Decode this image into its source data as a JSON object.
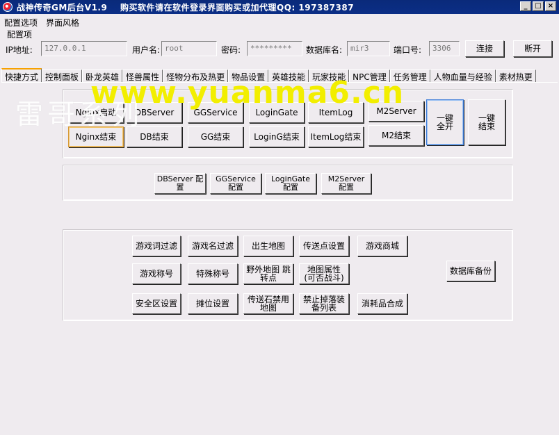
{
  "window": {
    "title": "战神传奇GM后台V1.9    购买软件请在软件登录界面购买或加代理QQ: 197387387",
    "buttons": {
      "minimize": "_",
      "maximize": "□",
      "close": "×"
    }
  },
  "menu": [
    "配置选项",
    "界面风格"
  ],
  "config": {
    "group_label": "配置项",
    "ip_label": "IP地址:",
    "ip_value": "127.0.0.1",
    "user_label": "用户名:",
    "user_value": "root",
    "password_label": "密码:",
    "password_value": "*********",
    "db_label": "数据库名:",
    "db_value": "mir3",
    "port_label": "端口号:",
    "port_value": "3306",
    "connect": "连接",
    "disconnect": "断开"
  },
  "tabs": [
    "快捷方式",
    "控制面板",
    "卧龙英雄",
    "怪兽属性",
    "怪物分布及热更",
    "物品设置",
    "英雄技能",
    "玩家技能",
    "NPC管理",
    "任务管理",
    "人物血量与经验",
    "素材热更"
  ],
  "server_buttons": {
    "start_row": [
      "Nginx启动",
      "DBServer",
      "GGService",
      "LoginGate",
      "ItemLog",
      "M2Server"
    ],
    "stop_row": [
      "Nginx结束",
      "DB结束",
      "GG结束",
      "LoginG结束",
      "ItemLog结束",
      "M2结束"
    ],
    "one_key_start": "一键\n全开",
    "one_key_stop": "一键\n结束"
  },
  "config_buttons": [
    "DBServer 配置",
    "GGService 配置",
    "LoginGate 配置",
    "M2Server 配置"
  ],
  "game_buttons": {
    "row1": [
      "游戏词过滤",
      "游戏名过滤",
      "出生地图",
      "传送点设置",
      "游戏商城"
    ],
    "row2": [
      "游戏称号",
      "特殊称号",
      "野外地图 跳转点",
      "地图属性 (可否战斗)"
    ],
    "row3": [
      "安全区设置",
      "摊位设置",
      "传送石禁用 地图",
      "禁止掉落装 备列表",
      "消耗品合成"
    ],
    "db_backup": "数据库备份"
  },
  "watermark": "www.yuanma6.cn",
  "watermark_cn": "雷哥系列"
}
